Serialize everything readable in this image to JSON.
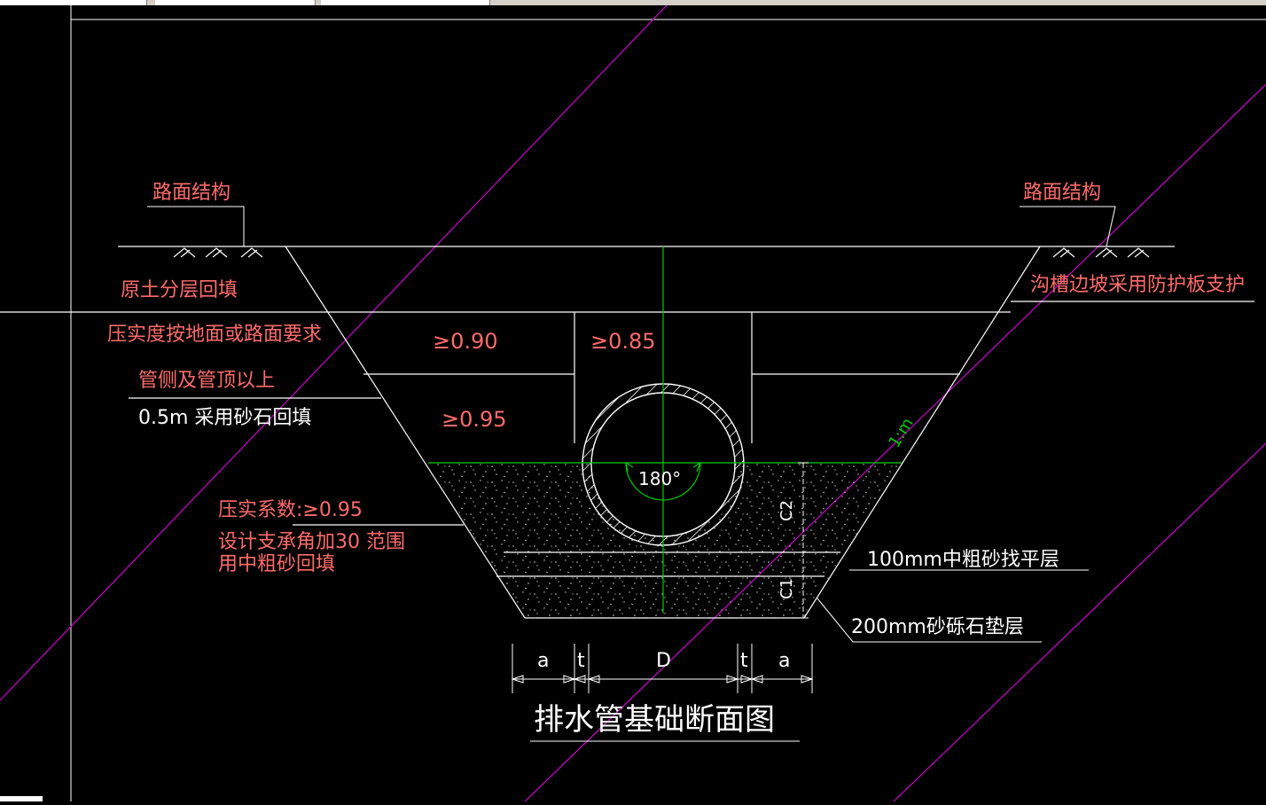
{
  "colors": {
    "background": "#000000",
    "line": "#ffffff",
    "annotation": "#ff6b6b",
    "centerline": "#00cc00",
    "construction": "#cc00cc"
  },
  "labels": {
    "road_left": "路面结构",
    "road_right": "路面结构",
    "backfill": "原土分层回填",
    "compaction": "压实度按地面或路面要求",
    "pipe_side": "管侧及管顶以上",
    "sand_fill": "0.5m  采用砂石回填",
    "slope_support": "沟槽边坡采用防护板支护",
    "val_090": "≥0.90",
    "val_085": "≥0.85",
    "val_095": "≥0.95",
    "angle": "180°",
    "slope": "1:m",
    "coef": "压实系数:≥0.95",
    "design_angle": "设计支承角加30  范围",
    "coarse_sand": "用中粗砂回填",
    "c2": "C2",
    "c1": "C1",
    "leveling": "100mm中粗砂找平层",
    "cushion": "200mm砂砾石垫层",
    "dim_a1": "a",
    "dim_t1": "t",
    "dim_d": "D",
    "dim_t2": "t",
    "dim_a2": "a",
    "title": "排水管基础断面图"
  }
}
